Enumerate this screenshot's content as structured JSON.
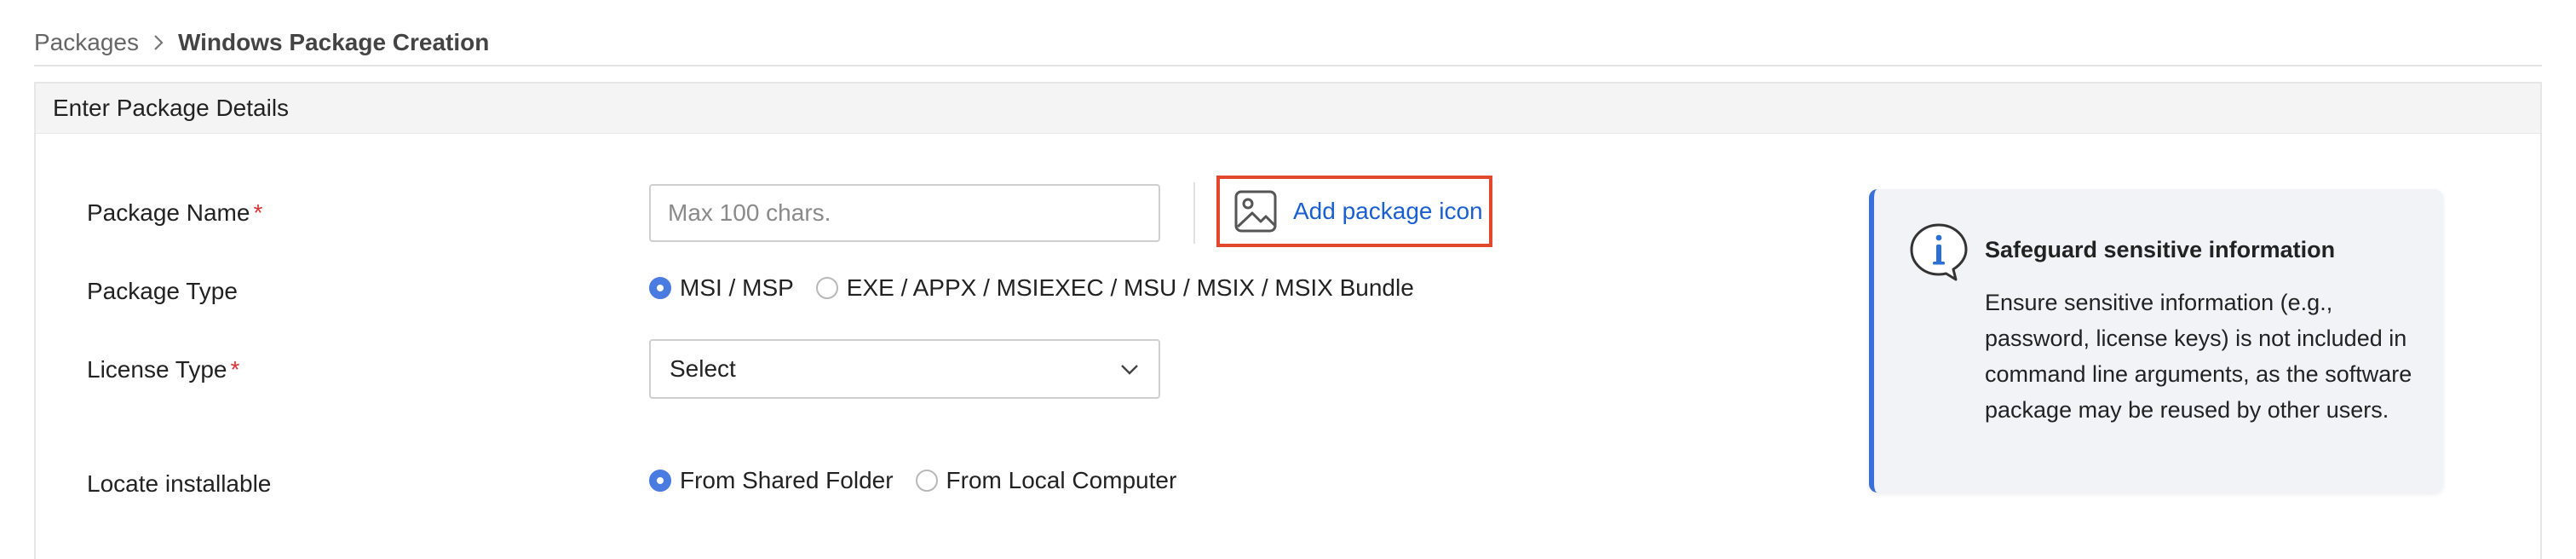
{
  "breadcrumb": {
    "parent": "Packages",
    "current": "Windows Package Creation"
  },
  "panel": {
    "title": "Enter Package Details"
  },
  "form": {
    "package_name": {
      "label": "Package Name",
      "required_mark": "*",
      "placeholder": "Max 100 chars.",
      "value": ""
    },
    "add_icon": {
      "label": "Add package icon",
      "icon": "image-icon"
    },
    "package_type": {
      "label": "Package Type",
      "options": [
        {
          "label": "MSI / MSP",
          "checked": true
        },
        {
          "label": "EXE / APPX / MSIEXEC / MSU / MSIX / MSIX Bundle",
          "checked": false
        }
      ]
    },
    "license_type": {
      "label": "License Type",
      "required_mark": "*",
      "selected": "Select"
    },
    "locate_installable": {
      "label": "Locate installable",
      "options": [
        {
          "label": "From Shared Folder",
          "checked": true
        },
        {
          "label": "From Local Computer",
          "checked": false
        }
      ]
    }
  },
  "info": {
    "icon": "info-speech-bubble-icon",
    "title": "Safeguard sensitive information",
    "body": "Ensure sensitive information (e.g., password, license keys) is not included in command line arguments, as the software package may be reused by other users."
  },
  "colors": {
    "accent": "#4a7be0",
    "link": "#1a5fd1",
    "highlight_border": "#e2482b",
    "required": "#dd3333",
    "info_border": "#3b6fd8"
  }
}
